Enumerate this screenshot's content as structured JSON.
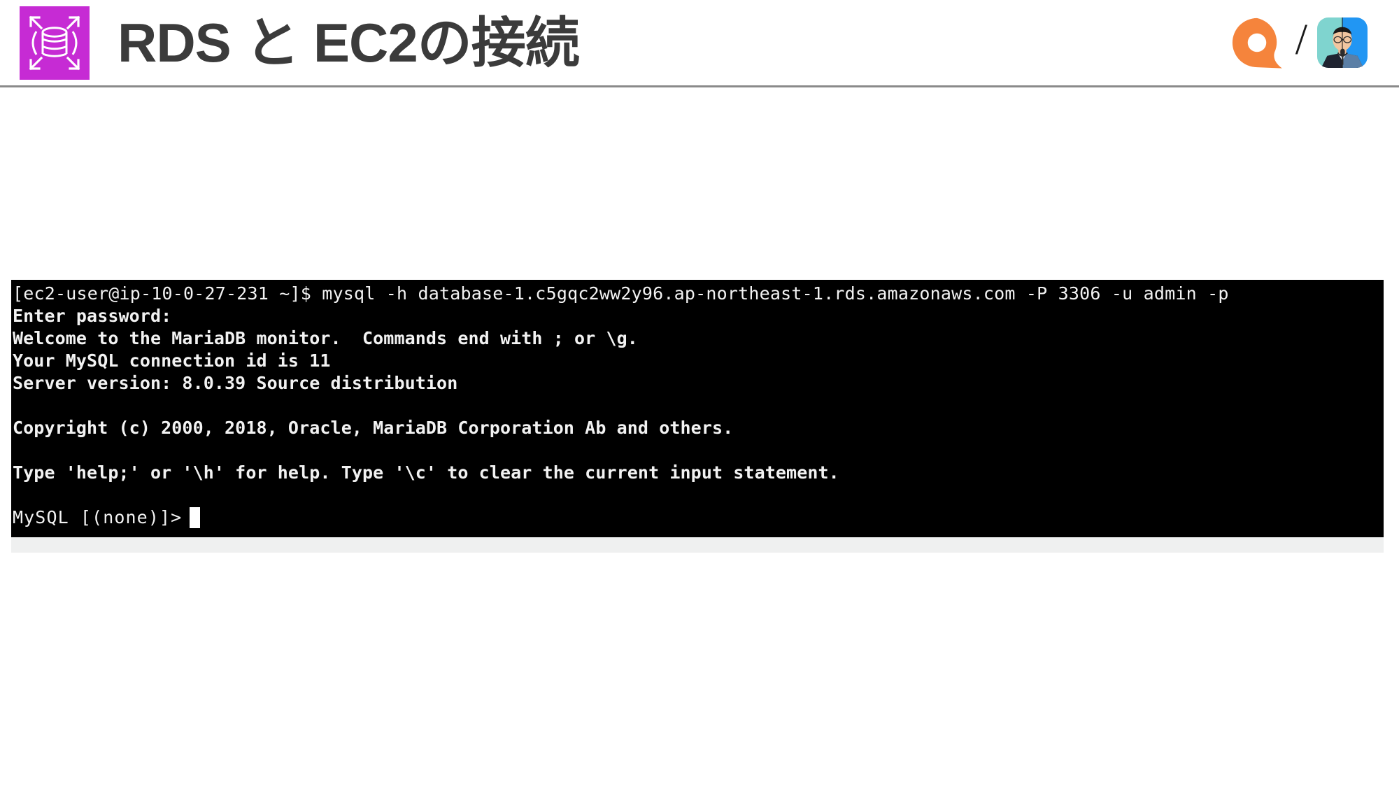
{
  "header": {
    "icon_name": "aws-rds-icon",
    "icon_color": "#C62BD4",
    "title": "RDS と EC2の接続",
    "title_color": "#3b3b3b",
    "brand_logo_name": "orange-pin-logo",
    "brand_logo_color": "#F5843C",
    "separator": "/",
    "avatar_name": "user-avatar"
  },
  "terminal": {
    "background": "#000000",
    "foreground": "#f2f2f2",
    "lines": [
      {
        "kind": "cmd",
        "text": "[ec2-user@ip-10-0-27-231 ~]$ mysql -h database-1.c5gqc2ww2y96.ap-northeast-1.rds.amazonaws.com -P 3306 -u admin -p"
      },
      {
        "kind": "out",
        "text": "Enter password:"
      },
      {
        "kind": "out",
        "text": "Welcome to the MariaDB monitor.  Commands end with ; or \\g."
      },
      {
        "kind": "out",
        "text": "Your MySQL connection id is 11"
      },
      {
        "kind": "out",
        "text": "Server version: 8.0.39 Source distribution"
      },
      {
        "kind": "blank",
        "text": ""
      },
      {
        "kind": "out",
        "text": "Copyright (c) 2000, 2018, Oracle, MariaDB Corporation Ab and others."
      },
      {
        "kind": "blank",
        "text": ""
      },
      {
        "kind": "out",
        "text": "Type 'help;' or '\\h' for help. Type '\\c' to clear the current input statement."
      },
      {
        "kind": "blank",
        "text": ""
      },
      {
        "kind": "prompt",
        "text": "MySQL [(none)]>"
      }
    ],
    "cursor": "block-cursor"
  }
}
